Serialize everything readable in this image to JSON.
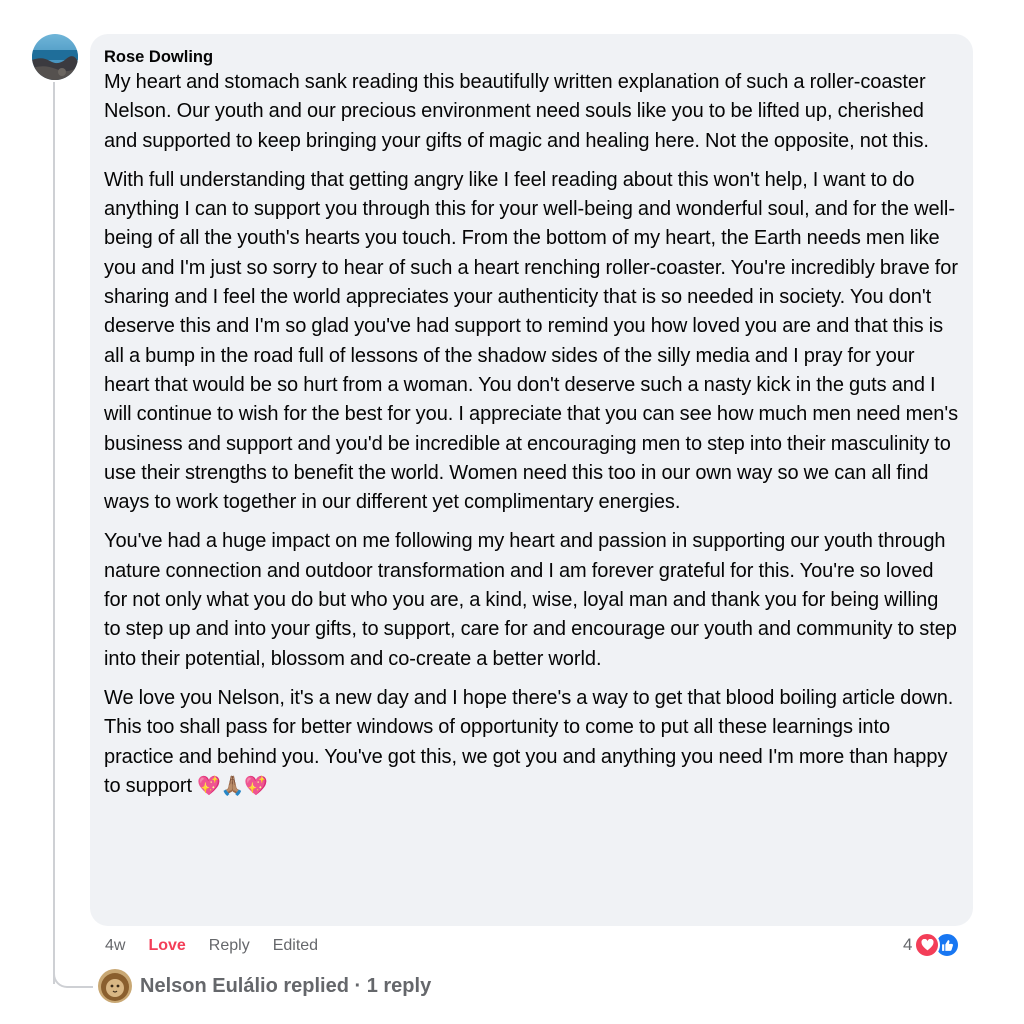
{
  "comment": {
    "author": "Rose Dowling",
    "paragraphs": [
      "My heart and stomach sank reading this beautifully written explanation of such a roller-coaster Nelson. Our youth and our precious environment need souls like you to be lifted up, cherished and supported to keep bringing your gifts of magic and healing here. Not the opposite, not this.",
      "With full understanding that getting angry like I feel reading about this won't help, I want to do anything I can to support you through this for your well-being and wonderful soul, and for the well-being of all the youth's hearts you touch. From the bottom of my heart, the Earth needs men like you and I'm just so sorry to hear of such a heart renching roller-coaster. You're incredibly brave for sharing and I feel the world appreciates your authenticity that is so needed in society. You don't deserve this and I'm so glad you've had support to remind you how loved you are and that this is all a bump in the road full of lessons of the shadow sides of the silly media and I pray for your heart that would be so hurt from a woman. You don't deserve such a nasty kick in the guts and I will continue to wish for the best for you. I appreciate that you can see how much men need men's business and support and you'd be incredible at encouraging men to step into their masculinity to use their strengths to benefit the world. Women need this too in our own way so we can all find ways to work together in our different yet complimentary energies.",
      "You've had a huge impact on me following my heart and passion in supporting our youth through nature connection and outdoor transformation and I am forever grateful for this. You're so loved for not only what you do but who you are, a kind, wise, loyal man and thank you for being willing to step up and into your gifts, to support, care for and encourage our youth and community to step into their potential, blossom and co-create a better world.",
      "We love you Nelson, it's a new day and I hope there's a way to get that blood boiling article down. This too shall pass for better windows of opportunity to come to put all these learnings into practice and behind you. You've got this, we got you and anything you need I'm more than happy to support"
    ],
    "emojis": "💖🙏🏽💖",
    "time": "4w",
    "love_label": "Love",
    "reply_label": "Reply",
    "edited_label": "Edited",
    "reaction_count": "4"
  },
  "reply_summary": {
    "text": "Nelson Eulálio replied · 1 reply"
  },
  "icons": {
    "heart_reaction": "heart-icon",
    "like_reaction": "thumbs-up-icon"
  },
  "colors": {
    "bubble_bg": "#f0f2f5",
    "love": "#f33e58",
    "like": "#1877f2",
    "meta_text": "#65676b"
  }
}
